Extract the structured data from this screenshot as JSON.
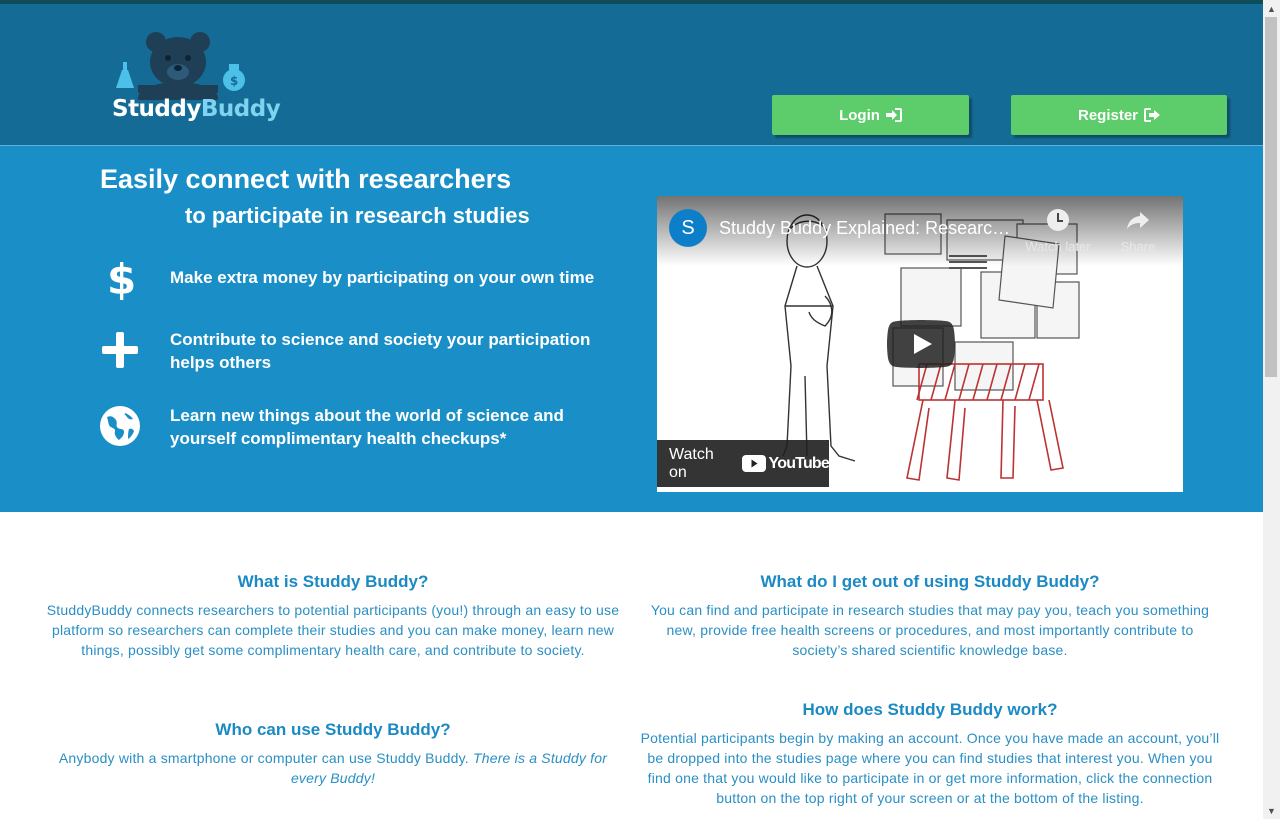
{
  "header": {
    "logo_text_1": "Studdy",
    "logo_text_2": "Buddy",
    "login_label": "Login",
    "register_label": "Register"
  },
  "hero": {
    "headline": "Easily connect with researchers",
    "subheadline": "to participate in research studies",
    "features": [
      {
        "icon": "dollar-icon",
        "text": "Make extra money by participating on your own time"
      },
      {
        "icon": "plus-icon",
        "text": "Contribute to science and society your participation helps others"
      },
      {
        "icon": "globe-icon",
        "text": "Learn new things about the world of science and yourself complimentary health checkups*"
      }
    ]
  },
  "video": {
    "channel_initial": "S",
    "title": "Studdy Buddy Explained: Research…",
    "watch_later": "Watch later",
    "share": "Share",
    "watch_on": "Watch on",
    "youtube": "YouTube"
  },
  "info": {
    "what_is": {
      "title": "What is Studdy Buddy?",
      "body": "StuddyBuddy connects researchers to potential participants (you!) through an easy to use platform so researchers can complete their studies and you can make money, learn new things, possibly get some complimentary health care, and contribute to society."
    },
    "who_can": {
      "title": "Who can use Studdy Buddy?",
      "body": "Anybody with a smartphone or computer can use Studdy Buddy.",
      "body_italic": "There is a Studdy for every Buddy!"
    },
    "what_get": {
      "title": "What do I get out of using Studdy Buddy?",
      "body": "You can find and participate in research studies that may pay you, teach you something new, provide free health screens or procedures, and most importantly contribute to society’s shared scientific knowledge base."
    },
    "how_work": {
      "title": "How does Studdy Buddy work?",
      "body": "Potential participants begin by making an account. Once you have made an account, you’ll be dropped into the studies page where you can find studies that interest you. When you find one that you would like to participate in or get more information, click the connection button on the top right of your screen or at the bottom of the listing."
    }
  },
  "colors": {
    "header_bg": "#146c96",
    "hero_bg": "#1a8fc7",
    "button_green": "#5dcc6a",
    "heading_blue": "#1b8ac4"
  }
}
